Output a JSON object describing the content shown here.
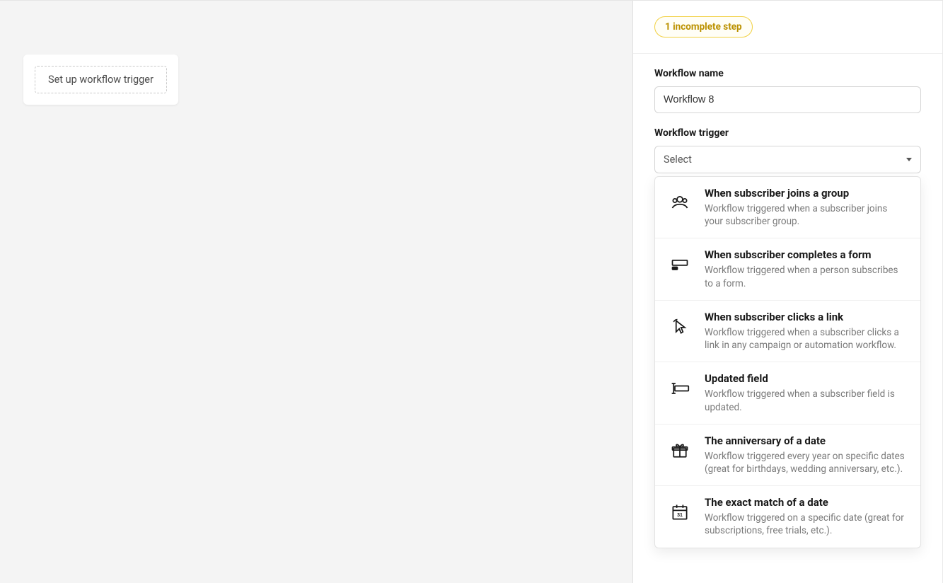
{
  "canvas": {
    "trigger_placeholder": "Set up workflow trigger"
  },
  "sidebar": {
    "badge": "1 incomplete step",
    "name_label": "Workflow name",
    "name_value": "Workflow 8",
    "trigger_label": "Workflow trigger",
    "select_placeholder": "Select",
    "options": [
      {
        "title": "When subscriber joins a group",
        "desc": "Workflow triggered when a subscriber joins your subscriber group."
      },
      {
        "title": "When subscriber completes a form",
        "desc": "Workflow triggered when a person subscribes to a form."
      },
      {
        "title": "When subscriber clicks a link",
        "desc": "Workflow triggered when a subscriber clicks a link in any campaign or automation workflow."
      },
      {
        "title": "Updated field",
        "desc": "Workflow triggered when a subscriber field is updated."
      },
      {
        "title": "The anniversary of a date",
        "desc": "Workflow triggered every year on specific dates (great for birthdays, wedding anniversary, etc.)."
      },
      {
        "title": "The exact match of a date",
        "desc": "Workflow triggered on a specific date (great for subscriptions, free trials, etc.)."
      }
    ]
  }
}
